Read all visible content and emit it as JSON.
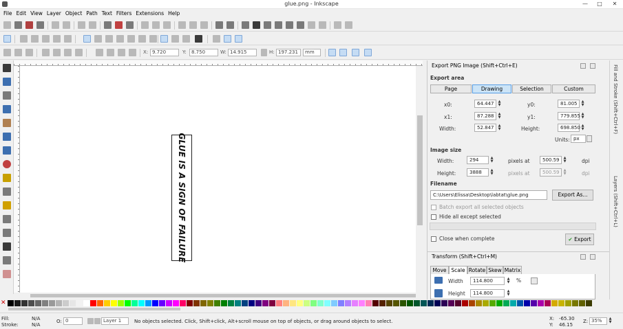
{
  "window": {
    "title": "glue.png - Inkscape",
    "minimize": "—",
    "maximize": "□",
    "close": "✕"
  },
  "menu": [
    "File",
    "Edit",
    "View",
    "Layer",
    "Object",
    "Path",
    "Text",
    "Filters",
    "Extensions",
    "Help"
  ],
  "tool_controls": {
    "x_label": "X:",
    "x_value": "9.720",
    "y_label": "Y:",
    "y_value": "8.750",
    "w_label": "W:",
    "w_value": "14.915",
    "h_label": "H:",
    "h_value": "197.231",
    "unit": "mm"
  },
  "canvas": {
    "text": "GLUE IS A SIGN OF FAILURE"
  },
  "export_panel": {
    "title": "Export PNG Image (Shift+Ctrl+E)",
    "export_area_label": "Export area",
    "area_buttons": [
      "Page",
      "Drawing",
      "Selection",
      "Custom"
    ],
    "x0_label": "x0:",
    "x0_value": "64.447",
    "y0_label": "y0:",
    "y0_value": "81.005",
    "x1_label": "x1:",
    "x1_value": "87.288",
    "y1_label": "y1:",
    "y1_value": "779.855",
    "width_label": "Width:",
    "width_value": "52.847",
    "height_label": "Height:",
    "height_value": "698.850",
    "units_label": "Units:",
    "units_value": "px",
    "image_size_label": "Image size",
    "img_width_label": "Width:",
    "img_width_value": "294",
    "img_height_label": "Height:",
    "img_height_value": "3888",
    "pixels_at_label": "pixels at",
    "dpi_value_1": "500.59",
    "dpi_value_2": "500.59",
    "dpi_label": "dpi",
    "filename_label": "Filename",
    "filename_value": "C:\\Users\\Elissa\\Desktop\\labtat\\glue.png",
    "export_as_label": "Export As...",
    "batch_label": "Batch export all selected objects",
    "hide_label": "Hide all except selected",
    "close_label": "Close when complete",
    "export_label": "Export"
  },
  "transform_panel": {
    "title": "Transform (Shift+Ctrl+M)",
    "tabs": [
      "Move",
      "Scale",
      "Rotate",
      "Skew",
      "Matrix"
    ],
    "width_label": "Width",
    "width_value": "114.800",
    "height_label": "Height",
    "height_value": "114.800",
    "unit": "%"
  },
  "dock_tabs": [
    "Fill and Stroke (Shift+Ctrl+F)",
    "Layers (Shift+Ctrl+L)"
  ],
  "status": {
    "fill_label": "Fill:",
    "fill_value": "N/A",
    "stroke_label": "Stroke:",
    "stroke_value": "N/A",
    "opacity_label": "O:",
    "opacity_value": "0",
    "layer_value": "Layer 1",
    "message": "No objects selected. Click, Shift+click, Alt+scroll mouse on top of objects, or drag around objects to select.",
    "x_label": "X:",
    "x_value": "-65.30",
    "y_label": "Y:",
    "y_value": "46.15",
    "zoom_label": "Z:",
    "zoom_value": "35%"
  },
  "palette_colors": [
    "#000000",
    "#1a1a1a",
    "#333333",
    "#4d4d4d",
    "#666666",
    "#808080",
    "#999999",
    "#b3b3b3",
    "#cccccc",
    "#e6e6e6",
    "#f2f2f2",
    "#ffffff",
    "#ff0000",
    "#ff6600",
    "#ffcc00",
    "#ffff00",
    "#99ff00",
    "#00ff00",
    "#00ff99",
    "#00ffff",
    "#0099ff",
    "#0000ff",
    "#6600ff",
    "#cc00ff",
    "#ff00ff",
    "#ff0066",
    "#800000",
    "#803300",
    "#806600",
    "#808000",
    "#408000",
    "#008000",
    "#008040",
    "#008080",
    "#004080",
    "#000080",
    "#400080",
    "#800080",
    "#800040",
    "#ff8080",
    "#ffb380",
    "#ffe680",
    "#ffff80",
    "#ccff80",
    "#80ff80",
    "#80ffcc",
    "#80ffff",
    "#80ccff",
    "#8080ff",
    "#b380ff",
    "#e680ff",
    "#ff80ff",
    "#ff80b3",
    "#550000",
    "#552200",
    "#554400",
    "#555500",
    "#2b5500",
    "#005500",
    "#00552b",
    "#005555",
    "#002b55",
    "#000055",
    "#2b0055",
    "#550055",
    "#55002b",
    "#aa0000",
    "#aa4400",
    "#aa8800",
    "#aaaa00",
    "#55aa00",
    "#00aa00",
    "#00aa55",
    "#00aaaa",
    "#0055aa",
    "#0000aa",
    "#5500aa",
    "#aa00aa",
    "#aa0055",
    "#d4aa00",
    "#c8b400",
    "#a0a000",
    "#787800",
    "#606000",
    "#3c3c00"
  ]
}
